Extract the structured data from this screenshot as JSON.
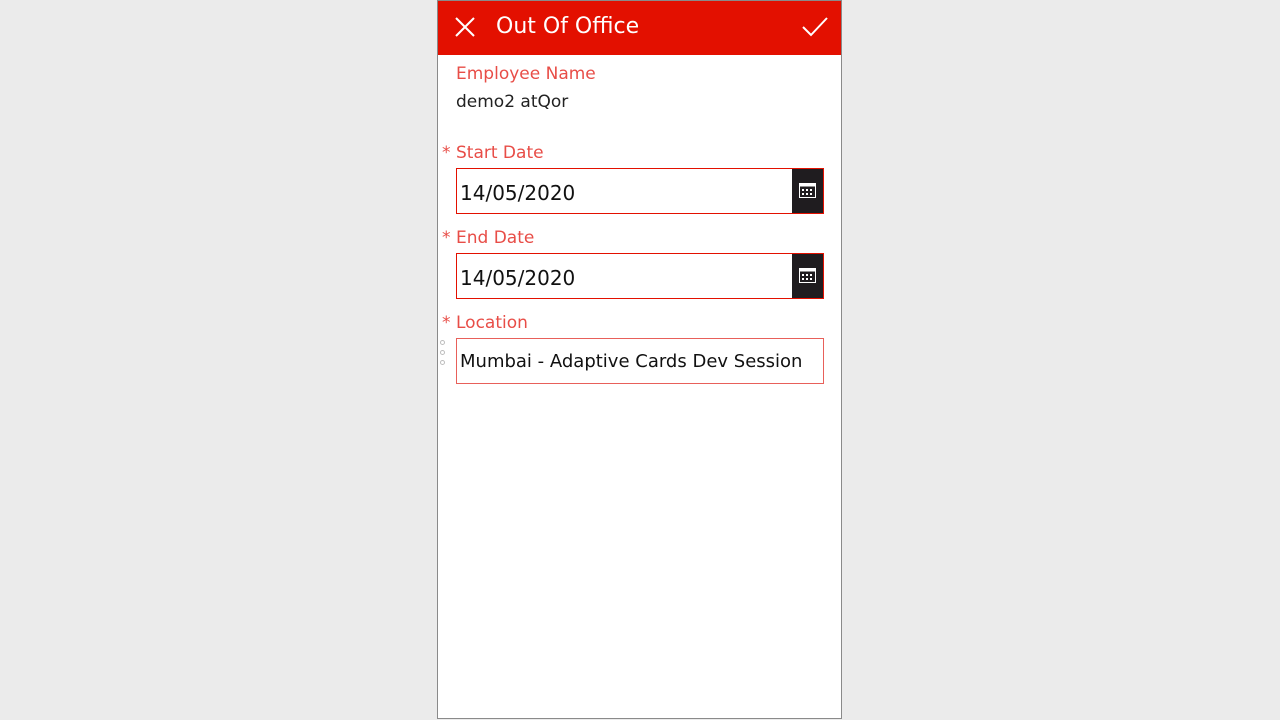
{
  "header": {
    "title": "Out Of Office",
    "close_icon": "close-icon",
    "confirm_icon": "checkmark-icon",
    "background_color": "#e31000"
  },
  "form": {
    "employee_name": {
      "label": "Employee Name",
      "value": "demo2 atQor"
    },
    "start_date": {
      "required_marker": "*",
      "label": "Start Date",
      "value": "14/05/2020",
      "picker_icon": "calendar-icon"
    },
    "end_date": {
      "required_marker": "*",
      "label": "End Date",
      "value": "14/05/2020",
      "picker_icon": "calendar-icon"
    },
    "location": {
      "required_marker": "*",
      "label": "Location",
      "value": "Mumbai - Adaptive Cards Dev Session"
    }
  },
  "colors": {
    "accent": "#e31000",
    "label": "#e84d47",
    "calendar_button": "#1f1c1f",
    "page_background": "#ebebeb"
  }
}
